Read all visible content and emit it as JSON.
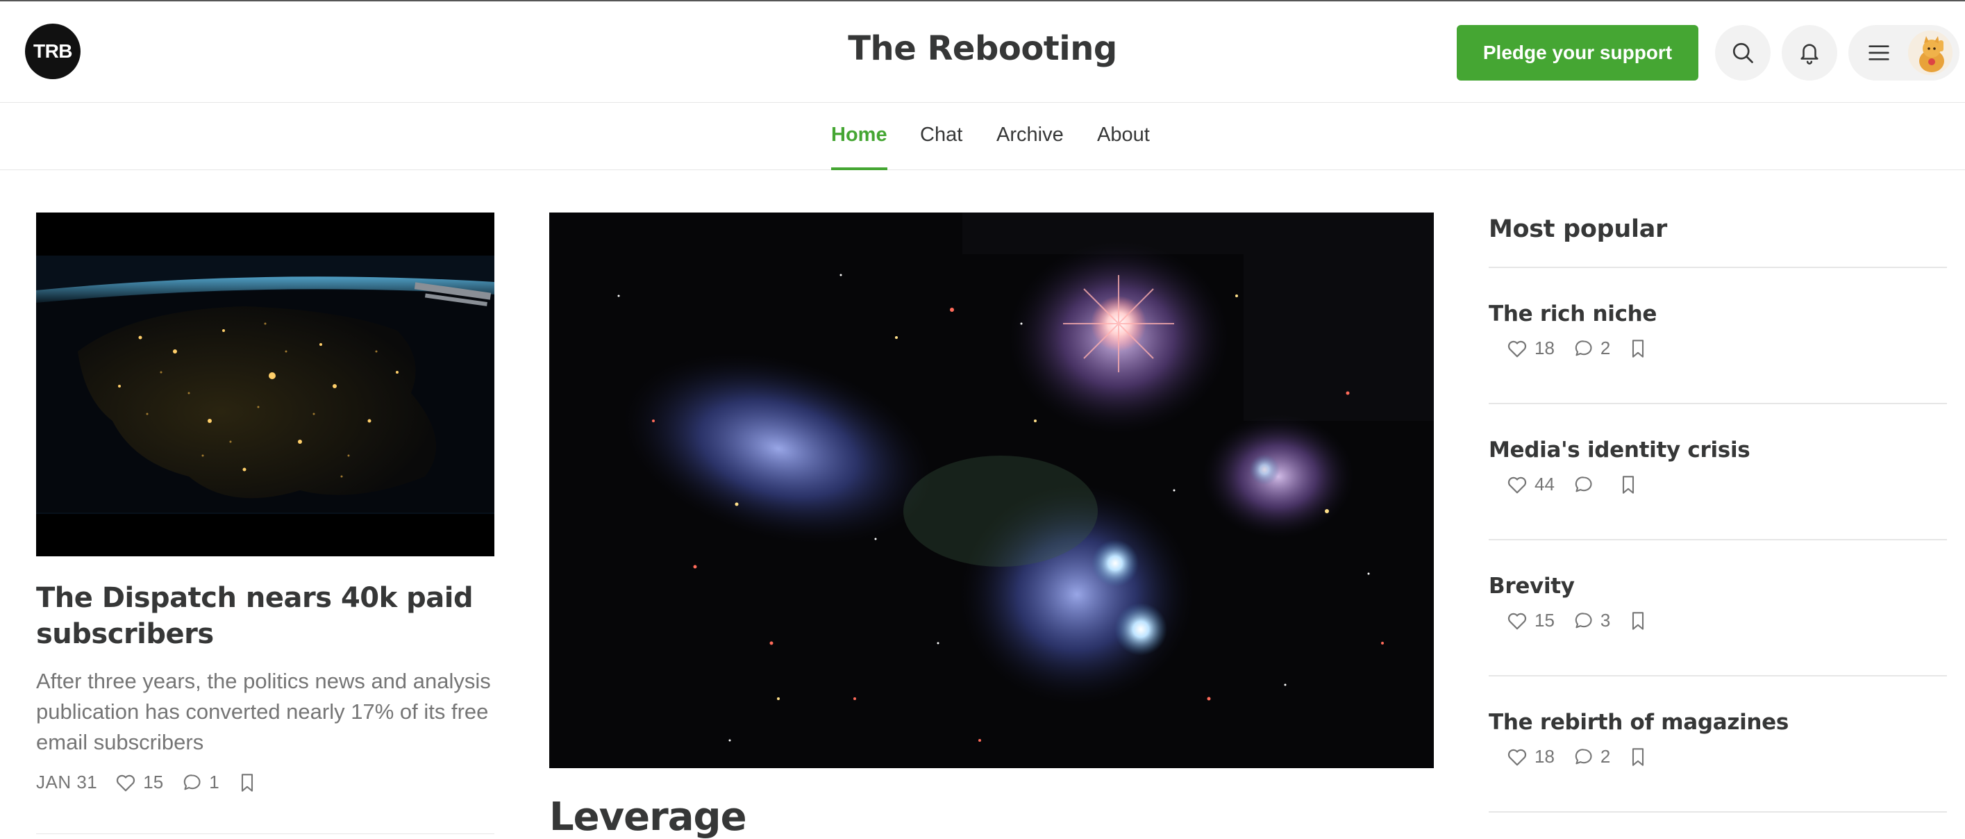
{
  "header": {
    "logo_text": "TRB",
    "site_title": "The Rebooting",
    "pledge_label": "Pledge your support",
    "icons": [
      "search-icon",
      "bell-icon",
      "menu-icon",
      "avatar"
    ]
  },
  "nav": {
    "tabs": [
      {
        "label": "Home",
        "active": true
      },
      {
        "label": "Chat",
        "active": false
      },
      {
        "label": "Archive",
        "active": false
      },
      {
        "label": "About",
        "active": false
      }
    ]
  },
  "left_post": {
    "title": "The Dispatch nears 40k paid subscribers",
    "subtitle": "After three years, the politics news and analysis publication has converted nearly 17% of its free email subscribers",
    "date": "JAN 31",
    "likes": "15",
    "comments": "1"
  },
  "center_post": {
    "title": "Leverage"
  },
  "most_popular": {
    "heading": "Most popular",
    "items": [
      {
        "title": "The rich niche",
        "likes": "18",
        "comments": "2"
      },
      {
        "title": "Media's identity crisis",
        "likes": "44",
        "comments": ""
      },
      {
        "title": "Brevity",
        "likes": "15",
        "comments": "3"
      },
      {
        "title": "The rebirth of magazines",
        "likes": "18",
        "comments": "2"
      }
    ]
  },
  "colors": {
    "accent": "#45a633",
    "text": "#363737",
    "muted": "#757575"
  }
}
